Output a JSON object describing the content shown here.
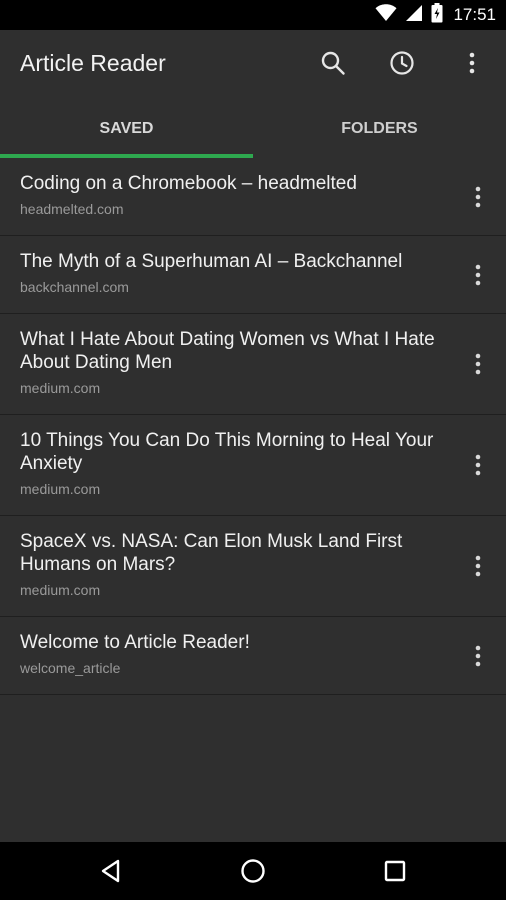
{
  "status_bar": {
    "time": "17:51",
    "icons": [
      "wifi-icon",
      "cellular-icon",
      "battery-icon"
    ]
  },
  "app_bar": {
    "title": "Article Reader",
    "actions": [
      "search-icon",
      "history-icon",
      "overflow-menu-icon"
    ]
  },
  "tabs": [
    {
      "label": "SAVED",
      "selected": true
    },
    {
      "label": "FOLDERS",
      "selected": false
    }
  ],
  "colors": {
    "accent": "#2ea84f",
    "background": "#2f2f2f",
    "text_primary": "#f0f0f0",
    "text_secondary": "#9a9a9a"
  },
  "articles": [
    {
      "title": "Coding on a Chromebook – headmelted",
      "source": "headmelted.com"
    },
    {
      "title": "The Myth of a Superhuman AI – Backchannel",
      "source": "backchannel.com"
    },
    {
      "title": "What I Hate About Dating Women vs What I Hate About Dating Men",
      "source": "medium.com"
    },
    {
      "title": "10 Things You Can Do This Morning to Heal Your Anxiety",
      "source": "medium.com"
    },
    {
      "title": "SpaceX vs. NASA: Can Elon Musk Land First Humans on Mars?",
      "source": "medium.com"
    },
    {
      "title": "Welcome to Article Reader!",
      "source": "welcome_article"
    }
  ],
  "nav_bar": {
    "buttons": [
      "back-icon",
      "home-icon",
      "recents-icon"
    ]
  }
}
